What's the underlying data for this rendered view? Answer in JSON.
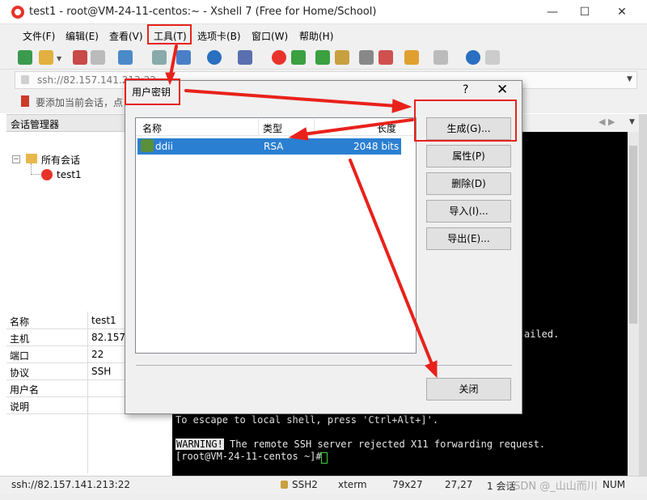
{
  "window": {
    "title": "test1 - root@VM-24-11-centos:~ - Xshell 7 (Free for Home/School)",
    "minimize": "—",
    "maximize": "☐",
    "close": "✕"
  },
  "menu": [
    "文件(F)",
    "编辑(E)",
    "查看(V)",
    "工具(T)",
    "选项卡(B)",
    "窗口(W)",
    "帮助(H)"
  ],
  "address": {
    "value": "ssh://82.157.141.213:22",
    "placeholder": ""
  },
  "hint": "要添加当前会话，点",
  "sessions": {
    "title": "会话管理器",
    "root": "所有会话",
    "item": "test1"
  },
  "properties": [
    {
      "key": "名称",
      "value": "test1"
    },
    {
      "key": "主机",
      "value": "82.157."
    },
    {
      "key": "端口",
      "value": "22"
    },
    {
      "key": "协议",
      "value": "SSH"
    },
    {
      "key": "用户名",
      "value": ""
    },
    {
      "key": "说明",
      "value": ""
    }
  ],
  "terminal": {
    "line_failed": "ailed.",
    "line_escape": "To escape to local shell, press 'Ctrl+Alt+]'.",
    "warning_label": "WARNING!",
    "warning_text": " The remote SSH server rejected X11 forwarding request.",
    "prompt": "[root@VM-24-11-centos ~]# "
  },
  "status": {
    "address": "ssh://82.157.141.213:22",
    "protocol": "SSH2",
    "term": "xterm",
    "size": "79x27",
    "pos": "27,27",
    "sessions": "1 会话",
    "caps": "NUM",
    "watermark": "CSDN @_山山而川"
  },
  "dialog": {
    "title": "用户密钥",
    "help": "?",
    "close": "✕",
    "columns": {
      "name": "名称",
      "type": "类型",
      "length": "长度"
    },
    "keys": [
      {
        "name": "ddii",
        "type": "RSA",
        "length": "2048 bits"
      }
    ],
    "buttons": {
      "generate": "生成(G)...",
      "properties": "属性(P)",
      "delete": "删除(D)",
      "import": "导入(I)...",
      "export": "导出(E)...",
      "close": "关闭"
    }
  },
  "colors": {
    "highlight": "#e8221b",
    "selection": "#2a7fd2",
    "terminal_bg": "#000000"
  }
}
